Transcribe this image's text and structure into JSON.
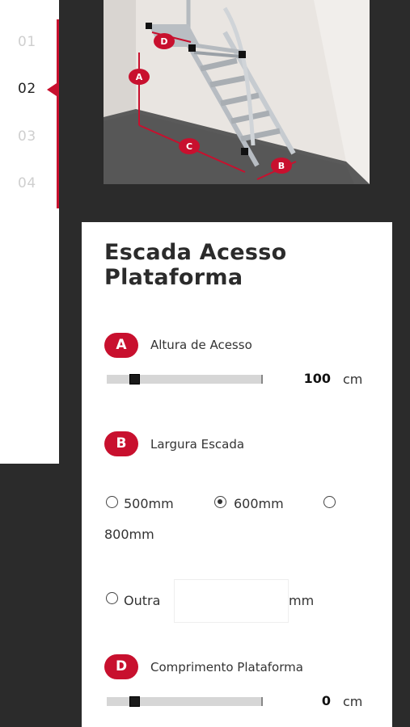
{
  "steps": [
    "01",
    "02",
    "03",
    "04"
  ],
  "active_step": "02",
  "illustration": {
    "markers": [
      "A",
      "B",
      "C",
      "D"
    ]
  },
  "form": {
    "title_line1": "Escada Acesso",
    "title_line2": "Plataforma",
    "field_a": {
      "badge": "A",
      "label": "Altura de Acesso",
      "value": "100",
      "unit": "cm",
      "level": 0.1
    },
    "field_b": {
      "badge": "B",
      "label": "Largura Escada",
      "options": [
        "500mm",
        "600mm",
        "800mm"
      ],
      "selected": "600mm",
      "other_label": "Outra",
      "other_unit": "mm",
      "other_value": ""
    },
    "field_d": {
      "badge": "D",
      "label": "Comprimento Plataforma",
      "value": "0",
      "unit": "cm",
      "level": 0.1
    }
  },
  "colors": {
    "accent": "#c8102e",
    "background": "#2b2b2b",
    "card": "#ffffff"
  }
}
